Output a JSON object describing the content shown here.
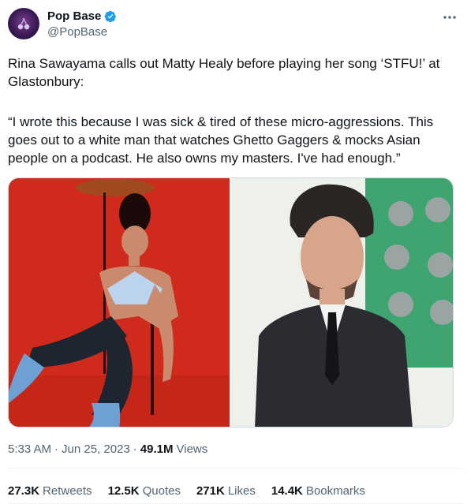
{
  "author": {
    "display_name": "Pop Base",
    "handle": "@PopBase",
    "verified_color": "#1d9bf0"
  },
  "tweet": {
    "text_1": "Rina Sawayama calls out Matty Healy before playing her song ‘STFU!’ at Glastonbury:",
    "text_2": "“I wrote this because I was sick & tired of these micro-aggressions. This goes out to a white man that watches Ghetto Gaggers & mocks Asian people on a podcast. He also owns my masters. I've had enough.”"
  },
  "meta": {
    "time": "5:33 AM",
    "date": "Jun 25, 2023",
    "separator": "·",
    "views_count": "49.1M",
    "views_label": "Views"
  },
  "stats": {
    "retweets_count": "27.3K",
    "retweets_label": "Retweets",
    "quotes_count": "12.5K",
    "quotes_label": "Quotes",
    "likes_count": "271K",
    "likes_label": "Likes",
    "bookmarks_count": "14.4K",
    "bookmarks_label": "Bookmarks"
  },
  "colors": {
    "text_primary": "#0f1419",
    "text_secondary": "#536471",
    "left_photo_bg": "#cf2a1c",
    "right_photo_bg": "#eef0ec"
  },
  "icons": {
    "verified": "verified-badge-icon",
    "more": "more-options-icon"
  }
}
